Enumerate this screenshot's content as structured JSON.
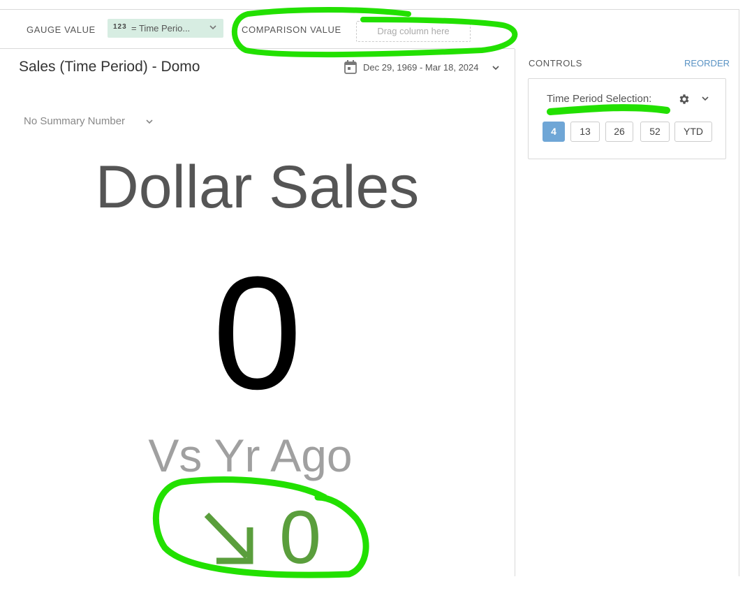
{
  "toolbar": {
    "gauge_value_label": "GAUGE VALUE",
    "gauge_pill": {
      "type_glyph": "123",
      "text": "= Time Perio..."
    },
    "comparison_value_label": "COMPARISON VALUE",
    "drop_placeholder": "Drag column here"
  },
  "card": {
    "title": "Sales (Time Period) - Domo",
    "date_range": "Dec 29, 1969 - Mar 18, 2024",
    "summary_number": "No Summary Number",
    "gauge_title": "Dollar Sales",
    "gauge_value": "0",
    "comparison_label": "Vs Yr Ago",
    "comparison_value": "0",
    "comparison_direction": "down",
    "comparison_color": "#5a9e3c"
  },
  "controls": {
    "label": "CONTROLS",
    "reorder": "REORDER",
    "filter": {
      "label": "Time Period Selection:",
      "options": [
        "4",
        "13",
        "26",
        "52",
        "YTD"
      ],
      "selected": "4"
    }
  },
  "annotations": {
    "highlight_color": "#22e000"
  }
}
